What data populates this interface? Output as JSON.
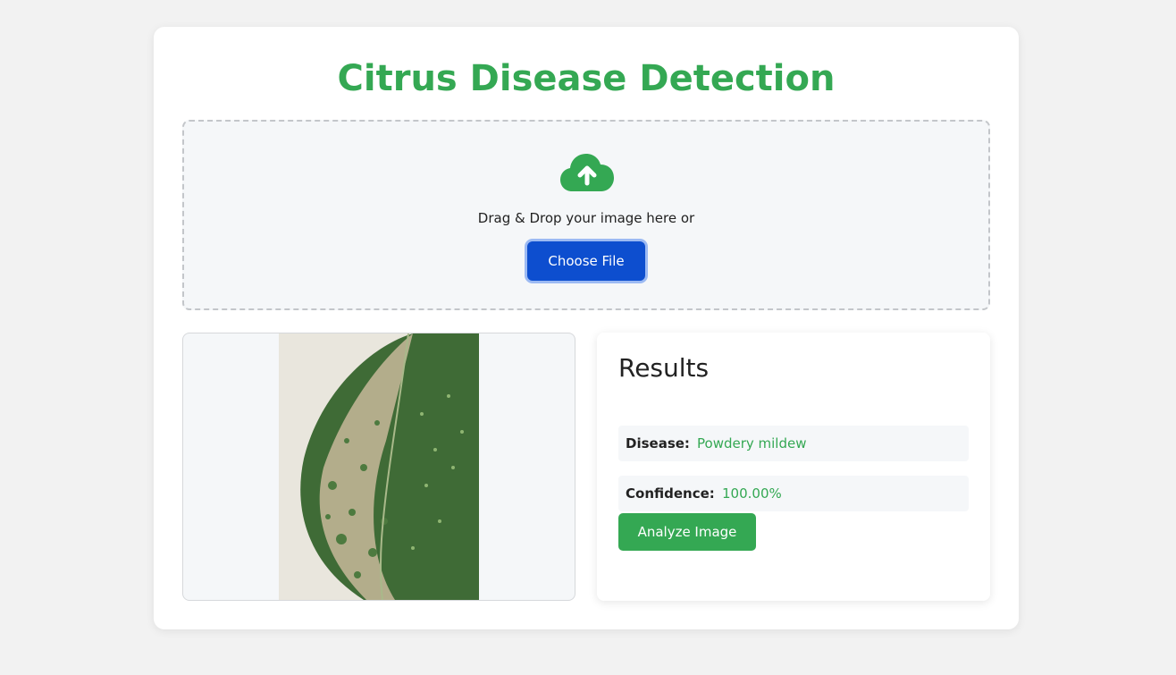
{
  "app": {
    "title": "Citrus Disease Detection"
  },
  "upload": {
    "icon": "cloud-upload-icon",
    "prompt": "Drag & Drop your image here or",
    "choose_label": "Choose File"
  },
  "preview": {
    "image": "citrus-leaf-photo"
  },
  "results": {
    "title": "Results",
    "disease_label": "Disease:",
    "disease_value": "Powdery mildew",
    "confidence_label": "Confidence:",
    "confidence_value": "100.00%",
    "analyze_label": "Analyze Image"
  },
  "colors": {
    "accent_green": "#34a853",
    "button_blue": "#0d4ecf",
    "page_background": "#f2f2f2"
  }
}
